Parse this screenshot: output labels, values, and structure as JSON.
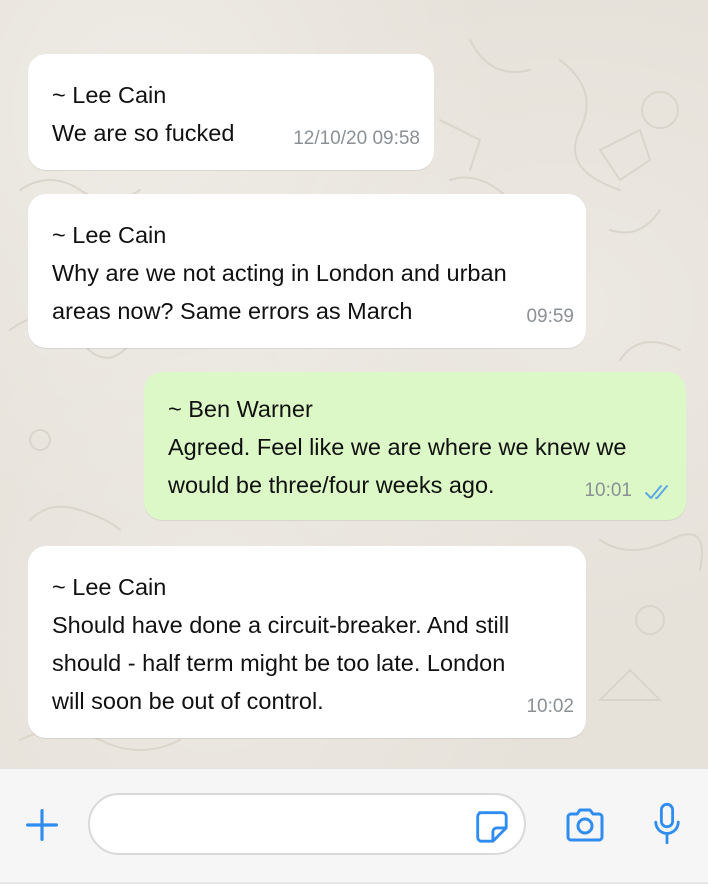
{
  "messages": [
    {
      "sender": "~ Lee Cain",
      "text": "We are so fucked",
      "time": "12/10/20 09:58",
      "direction": "incoming"
    },
    {
      "sender": "~ Lee Cain",
      "lines": [
        "Why are we not acting in London and urban",
        "areas now? Same errors as March"
      ],
      "time": "09:59",
      "direction": "incoming"
    },
    {
      "sender": "~ Ben Warner",
      "lines": [
        "Agreed. Feel like we are where we knew we",
        "would be three/four weeks ago."
      ],
      "time": "10:01",
      "direction": "outgoing",
      "status": "read"
    },
    {
      "sender": "~ Lee Cain",
      "lines": [
        "Should have done a circuit-breaker. And still",
        "should - half term might be too late. London",
        "will soon be out of control."
      ],
      "time": "10:02",
      "direction": "incoming"
    }
  ],
  "input_bar": {
    "add_icon": "plus-icon",
    "message_placeholder": "",
    "sticker_icon": "sticker-icon",
    "camera_icon": "camera-icon",
    "mic_icon": "microphone-icon"
  },
  "colors": {
    "incoming_bubble": "#ffffff",
    "outgoing_bubble": "#dcf8c6",
    "accent": "#2f8cf0",
    "read_ticks": "#5aa9e6",
    "timestamp": "#8a9196"
  }
}
